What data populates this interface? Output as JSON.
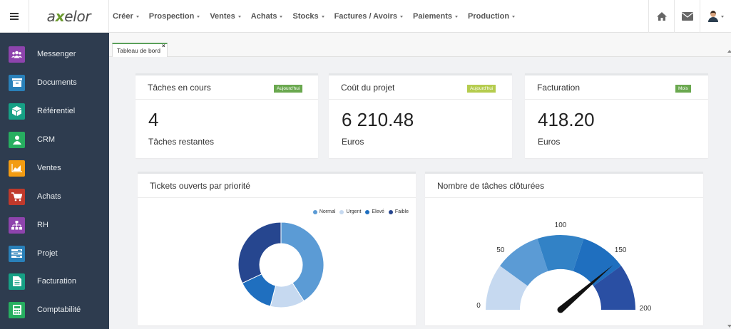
{
  "app": {
    "logo": "axelor",
    "logo_prefix": "a",
    "logo_mark": "x",
    "logo_suffix": "elor"
  },
  "topnav": [
    {
      "label": "Créer"
    },
    {
      "label": "Prospection"
    },
    {
      "label": "Ventes"
    },
    {
      "label": "Achats"
    },
    {
      "label": "Stocks"
    },
    {
      "label": "Factures / Avoirs"
    },
    {
      "label": "Paiements"
    },
    {
      "label": "Production"
    }
  ],
  "topicons": {
    "home": "home-icon",
    "mail": "envelope-icon",
    "user": "user-avatar"
  },
  "sidebar": [
    {
      "label": "Messenger",
      "icon": "users-icon",
      "color": "#8e44ad"
    },
    {
      "label": "Documents",
      "icon": "archive-box-icon",
      "color": "#2980b9"
    },
    {
      "label": "Référentiel",
      "icon": "cube-icon",
      "color": "#16a085"
    },
    {
      "label": "CRM",
      "icon": "user-icon",
      "color": "#27ae60"
    },
    {
      "label": "Ventes",
      "icon": "area-chart-icon",
      "color": "#f39c12"
    },
    {
      "label": "Achats",
      "icon": "shopping-cart-icon",
      "color": "#c0392b"
    },
    {
      "label": "RH",
      "icon": "org-chart-icon",
      "color": "#8e44ad"
    },
    {
      "label": "Projet",
      "icon": "tasks-icon",
      "color": "#2980b9"
    },
    {
      "label": "Facturation",
      "icon": "file-text-icon",
      "color": "#16a085"
    },
    {
      "label": "Comptabilité",
      "icon": "calculator-icon",
      "color": "#27ae60"
    }
  ],
  "tabs": [
    {
      "label": "Tableau de bord",
      "close": "×"
    }
  ],
  "cards": {
    "tasks": {
      "title": "Tâches en cours",
      "badge": "Aujourd'hui",
      "badge_color": "#6aa84f",
      "value": "4",
      "label": "Tâches restantes"
    },
    "cost": {
      "title": "Coût du projet",
      "badge": "Aujourd'hui",
      "badge_color": "#b5cc4e",
      "value": "6 210.48",
      "label": "Euros"
    },
    "billing": {
      "title": "Facturation",
      "badge": "Mois",
      "badge_color": "#6aa84f",
      "value": "418.20",
      "label": "Euros"
    }
  },
  "chart_data": [
    {
      "type": "pie",
      "title": "Tickets ouverts par priorité",
      "categories": [
        "Normal",
        "Urgent",
        "Elevé",
        "Faible"
      ],
      "values": [
        41,
        13,
        14,
        32
      ],
      "colors": [
        "#5b9bd5",
        "#c6d9f0",
        "#1f6fbf",
        "#26468f"
      ],
      "legend": "top-right",
      "donut": true
    },
    {
      "type": "gauge",
      "title": "Nombre de tâches clôturées",
      "min": 0,
      "max": 200,
      "value": 155,
      "tick_labels": [
        "0",
        "50",
        "100",
        "150",
        "200"
      ],
      "bands": [
        {
          "from": 0,
          "to": 40,
          "color": "#c6d9f0"
        },
        {
          "from": 40,
          "to": 80,
          "color": "#5b9bd5"
        },
        {
          "from": 80,
          "to": 120,
          "color": "#3282c6"
        },
        {
          "from": 120,
          "to": 160,
          "color": "#1f6fbf"
        },
        {
          "from": 160,
          "to": 200,
          "color": "#2a4fa3"
        }
      ]
    }
  ]
}
